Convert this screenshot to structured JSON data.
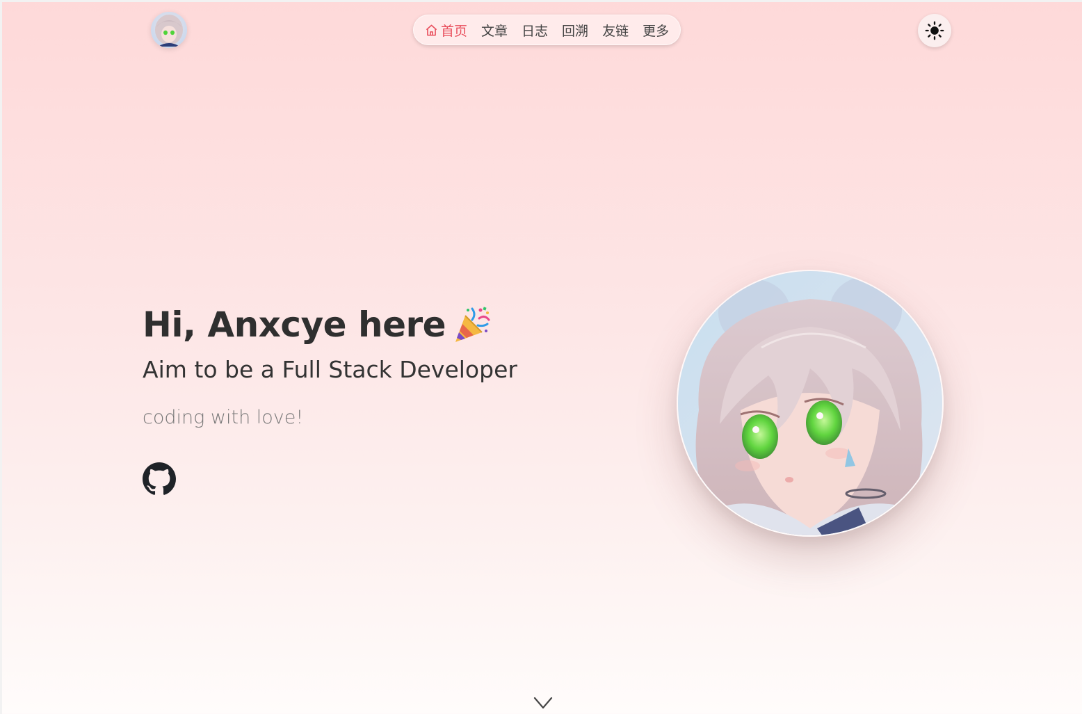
{
  "header": {
    "avatar_alt": "site avatar",
    "nav": [
      {
        "label": "首页",
        "icon": "home-icon",
        "active": true
      },
      {
        "label": "文章",
        "active": false
      },
      {
        "label": "日志",
        "active": false
      },
      {
        "label": "回溯",
        "active": false
      },
      {
        "label": "友链",
        "active": false
      },
      {
        "label": "更多",
        "active": false
      }
    ],
    "theme_icon": "sun-icon"
  },
  "hero": {
    "title": "Hi, Anxcye here",
    "title_emoji": "party-popper-icon",
    "subtitle": "Aim to be a Full Stack Developer",
    "tagline": "coding with love!",
    "social": [
      {
        "name": "github-icon"
      }
    ]
  },
  "colors": {
    "accent": "#e84c5a",
    "text_dark": "#2f2f2f",
    "text_muted": "#777777",
    "bg_top": "#fed9d9",
    "bg_bottom": "#fffcfb"
  },
  "scroll_icon": "chevron-down-icon"
}
